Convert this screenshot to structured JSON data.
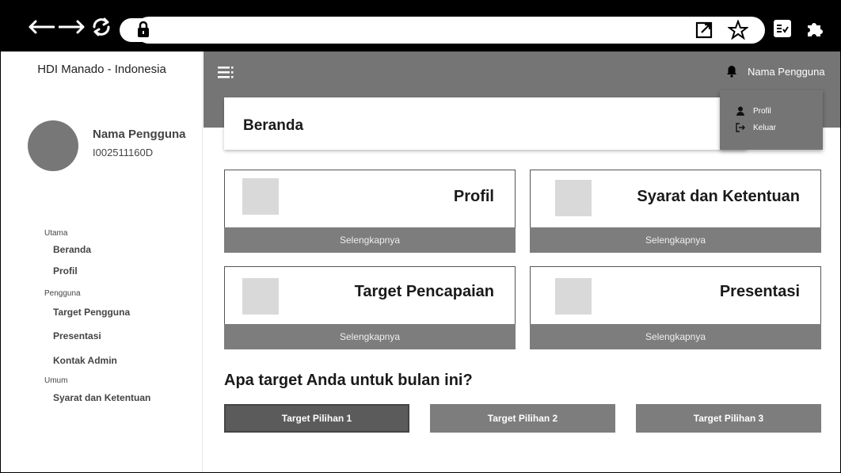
{
  "sidebar": {
    "brand": "HDI Manado - Indonesia",
    "user_name": "Nama Pengguna",
    "user_id": "I002511160D",
    "sections": [
      {
        "label": "Utama",
        "items": [
          "Beranda",
          "Profil"
        ]
      },
      {
        "label": "Pengguna",
        "items": [
          "Target Pengguna",
          "Presentasi",
          "Kontak Admin"
        ]
      },
      {
        "label": "Umum",
        "items": [
          "Syarat dan Ketentuan"
        ]
      }
    ]
  },
  "topbar": {
    "user_name": "Nama Pengguna",
    "dropdown": [
      "Profil",
      "Keluar"
    ]
  },
  "page": {
    "title": "Beranda"
  },
  "cards": [
    {
      "title": "Profil",
      "more": "Selengkapnya"
    },
    {
      "title": "Syarat dan Ketentuan",
      "more": "Selengkapnya"
    },
    {
      "title": "Target Pencapaian",
      "more": "Selengkapnya"
    },
    {
      "title": "Presentasi",
      "more": "Selengkapnya"
    }
  ],
  "targets": {
    "question": "Apa target Anda untuk bulan ini?",
    "options": [
      "Target Pilihan 1",
      "Target Pilihan 2",
      "Target Pilihan 3"
    ]
  },
  "colors": {
    "chrome": "#000000",
    "appbar": "#757575",
    "accent_button": "#7d7d7d",
    "active_button": "#5b5b5b"
  }
}
